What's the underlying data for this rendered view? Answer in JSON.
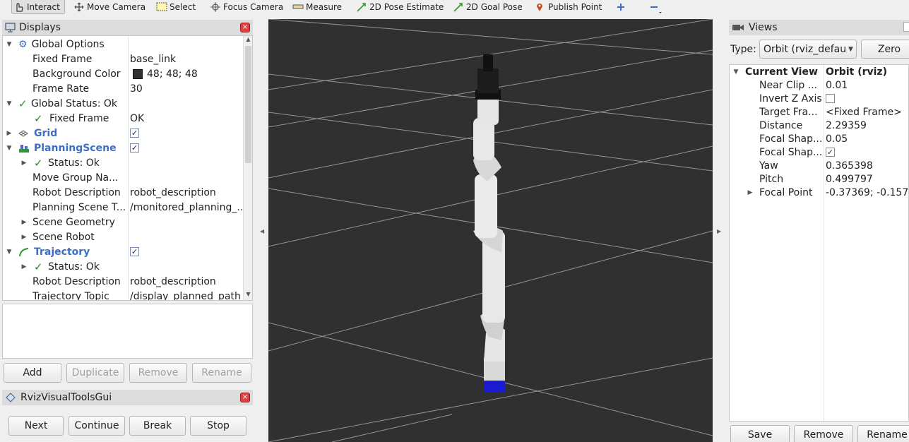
{
  "toolbar": {
    "interact": "Interact",
    "move_camera": "Move Camera",
    "select": "Select",
    "focus_camera": "Focus Camera",
    "measure": "Measure",
    "pose_estimate": "2D Pose Estimate",
    "goal_pose": "2D Goal Pose",
    "publish_point": "Publish Point"
  },
  "displays": {
    "title": "Displays",
    "rows": [
      {
        "label": "Global Options",
        "value": ""
      },
      {
        "label": "Fixed Frame",
        "value": "base_link"
      },
      {
        "label": "Background Color",
        "value": "48; 48; 48"
      },
      {
        "label": "Frame Rate",
        "value": "30"
      },
      {
        "label": "Global Status: Ok",
        "value": ""
      },
      {
        "label": "Fixed Frame",
        "value": "OK"
      },
      {
        "label": "Grid",
        "value": ""
      },
      {
        "label": "PlanningScene",
        "value": ""
      },
      {
        "label": "Status: Ok",
        "value": ""
      },
      {
        "label": "Move Group Na...",
        "value": ""
      },
      {
        "label": "Robot Description",
        "value": "robot_description"
      },
      {
        "label": "Planning Scene T...",
        "value": "/monitored_planning_..."
      },
      {
        "label": "Scene Geometry",
        "value": ""
      },
      {
        "label": "Scene Robot",
        "value": ""
      },
      {
        "label": "Trajectory",
        "value": ""
      },
      {
        "label": "Status: Ok",
        "value": ""
      },
      {
        "label": "Robot Description",
        "value": "robot_description"
      },
      {
        "label": "Trajectory Topic",
        "value": "/display_planned_path"
      }
    ],
    "buttons": {
      "add": "Add",
      "duplicate": "Duplicate",
      "remove": "Remove",
      "rename": "Rename"
    }
  },
  "rviz_gui": {
    "title": "RvizVisualToolsGui",
    "buttons": {
      "next": "Next",
      "continue": "Continue",
      "break": "Break",
      "stop": "Stop"
    }
  },
  "views": {
    "title": "Views",
    "type_label": "Type:",
    "type_value": "Orbit (rviz_defau",
    "zero": "Zero",
    "rows": [
      {
        "label": "Current View",
        "value": "Orbit (rviz)"
      },
      {
        "label": "Near Clip ...",
        "value": "0.01"
      },
      {
        "label": "Invert Z Axis",
        "value": ""
      },
      {
        "label": "Target Fra...",
        "value": "<Fixed Frame>"
      },
      {
        "label": "Distance",
        "value": "2.29359"
      },
      {
        "label": "Focal Shap...",
        "value": "0.05"
      },
      {
        "label": "Focal Shap...",
        "value": ""
      },
      {
        "label": "Yaw",
        "value": "0.365398"
      },
      {
        "label": "Pitch",
        "value": "0.499797"
      },
      {
        "label": "Focal Point",
        "value": "-0.37369; -0.157..."
      }
    ],
    "buttons": {
      "save": "Save",
      "remove": "Remove",
      "rename": "Rename"
    }
  },
  "colors": {
    "viewport_bg": "#303030",
    "grid_line": "#a0a0a0",
    "accent_blue": "#3b6fc4",
    "robot_base": "#1a1ad0"
  }
}
